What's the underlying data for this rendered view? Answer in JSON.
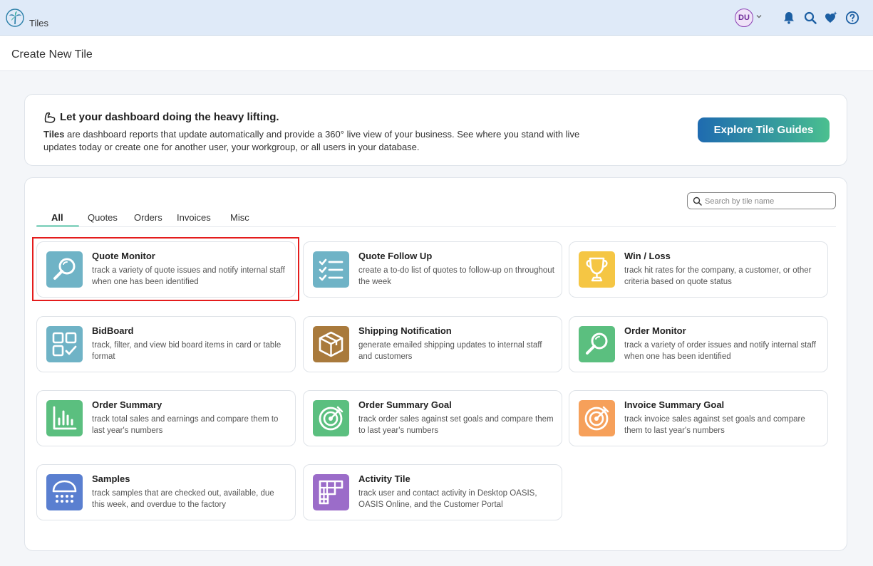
{
  "topbar": {
    "app_title": "Tiles",
    "user_initials": "DU"
  },
  "page": {
    "title": "Create New Tile"
  },
  "intro": {
    "heading": "Let your dashboard doing the heavy lifting.",
    "text_bold": "Tiles",
    "text_rest": " are dashboard reports that update automatically and provide a 360° live view of your business. See where you stand with live updates today or create one for another user, your workgroup, or all users in your database.",
    "button_label": "Explore Tile Guides"
  },
  "search": {
    "placeholder": "Search by tile name"
  },
  "tabs": [
    {
      "label": "All",
      "active": true
    },
    {
      "label": "Quotes",
      "active": false
    },
    {
      "label": "Orders",
      "active": false
    },
    {
      "label": "Invoices",
      "active": false
    },
    {
      "label": "Misc",
      "active": false
    }
  ],
  "tiles": [
    {
      "title": "Quote Monitor",
      "desc": "track a variety of quote issues and notify internal staff when one has been identified",
      "icon": "magnifier-icon",
      "color": "#6fb3c6"
    },
    {
      "title": "Quote Follow Up",
      "desc": "create a to-do list of quotes to follow-up on throughout the week",
      "icon": "checklist-icon",
      "color": "#6fb3c6"
    },
    {
      "title": "Win / Loss",
      "desc": "track hit rates for the company, a customer, or other criteria based on quote status",
      "icon": "trophy-icon",
      "color": "#f5c644"
    },
    {
      "title": "BidBoard",
      "desc": "track, filter, and view bid board items in card or table format",
      "icon": "grid-check-icon",
      "color": "#6fb3c6"
    },
    {
      "title": "Shipping Notification",
      "desc": "generate emailed shipping updates to internal staff and customers",
      "icon": "box-icon",
      "color": "#a97a3c"
    },
    {
      "title": "Order Monitor",
      "desc": "track a variety of order issues and notify internal staff when one has been identified",
      "icon": "magnifier-icon",
      "color": "#5bbf7f"
    },
    {
      "title": "Order Summary",
      "desc": "track total sales and earnings and compare them to last year's numbers",
      "icon": "bar-chart-icon",
      "color": "#5bbf7f"
    },
    {
      "title": "Order Summary Goal",
      "desc": "track order sales against set goals and compare them to last year's numbers",
      "icon": "target-icon",
      "color": "#5bbf7f"
    },
    {
      "title": "Invoice Summary Goal",
      "desc": "track invoice sales against set goals and compare them to last year's numbers",
      "icon": "target-icon",
      "color": "#f6a05a"
    },
    {
      "title": "Samples",
      "desc": "track samples that are checked out, available, due this week, and overdue to the factory",
      "icon": "calendar-dome-icon",
      "color": "#5a7fd0"
    },
    {
      "title": "Activity Tile",
      "desc": "track user and contact activity in Desktop OASIS, OASIS Online, and the Customer Portal",
      "icon": "activity-grid-icon",
      "color": "#9b6cc9"
    }
  ]
}
